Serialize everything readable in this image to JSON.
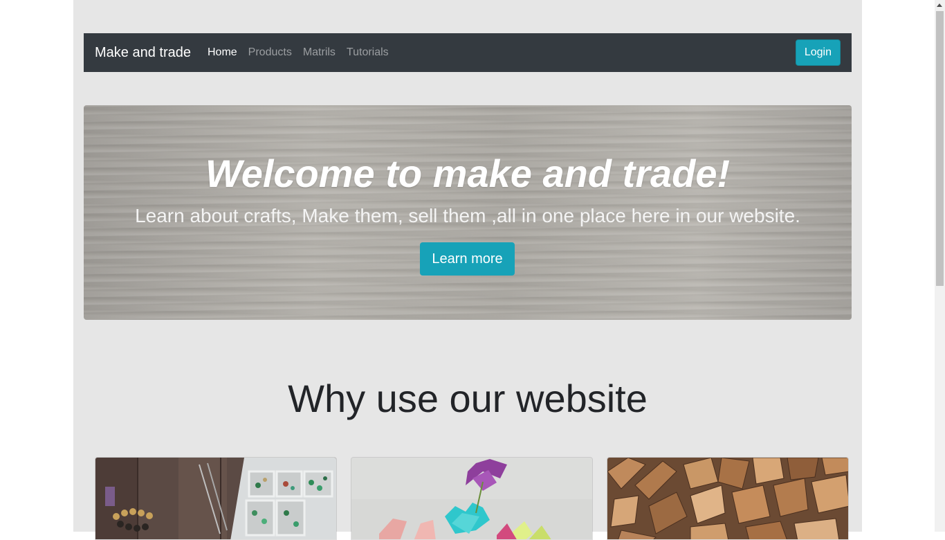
{
  "nav": {
    "brand": "Make and trade",
    "links": [
      {
        "label": "Home",
        "active": true
      },
      {
        "label": "Products",
        "active": false
      },
      {
        "label": "Matrils",
        "active": false
      },
      {
        "label": "Tutorials",
        "active": false
      }
    ],
    "login_label": "Login"
  },
  "hero": {
    "title": "Welcome to make and trade!",
    "subtitle": "Learn about crafts, Make them, sell them ,all in one place here in our website.",
    "button_label": "Learn more"
  },
  "features": {
    "title": "Why use our website",
    "cards": [
      {
        "image": "jewelry-beads-photo"
      },
      {
        "image": "paper-flowers-photo"
      },
      {
        "image": "wood-pieces-photo"
      }
    ]
  },
  "colors": {
    "navbar": "#343a40",
    "accent": "#17a2b8",
    "page_background": "#e6e6e6"
  }
}
